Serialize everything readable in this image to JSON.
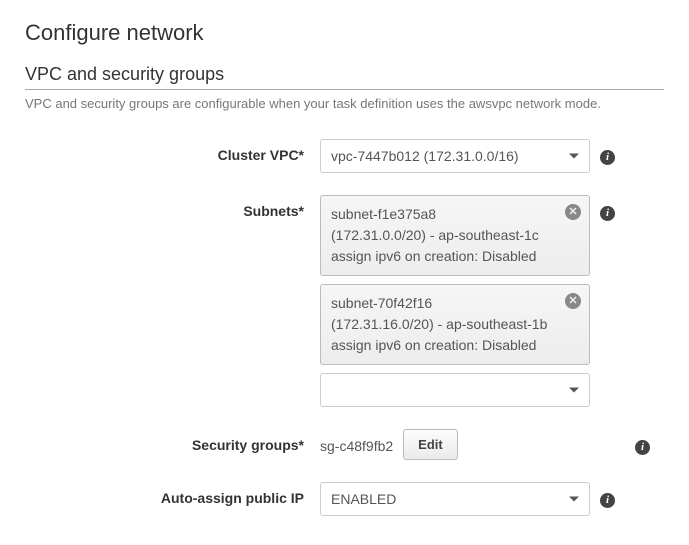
{
  "page": {
    "title": "Configure network"
  },
  "section": {
    "title": "VPC and security groups",
    "description": "VPC and security groups are configurable when your task definition uses the awsvpc network mode."
  },
  "vpc": {
    "label": "Cluster VPC*",
    "selected": "vpc-7447b012 (172.31.0.0/16)"
  },
  "subnets": {
    "label": "Subnets*",
    "items": [
      {
        "id": "subnet-f1e375a8",
        "details": "(172.31.0.0/20) - ap-southeast-1c",
        "ipv6": "assign ipv6 on creation: Disabled"
      },
      {
        "id": "subnet-70f42f16",
        "details": "(172.31.16.0/20) - ap-southeast-1b",
        "ipv6": "assign ipv6 on creation: Disabled"
      }
    ]
  },
  "securityGroups": {
    "label": "Security groups*",
    "value": "sg-c48f9fb2",
    "editLabel": "Edit"
  },
  "autoAssign": {
    "label": "Auto-assign public IP",
    "selected": "ENABLED"
  },
  "icons": {
    "info": "i",
    "remove": "✕"
  }
}
